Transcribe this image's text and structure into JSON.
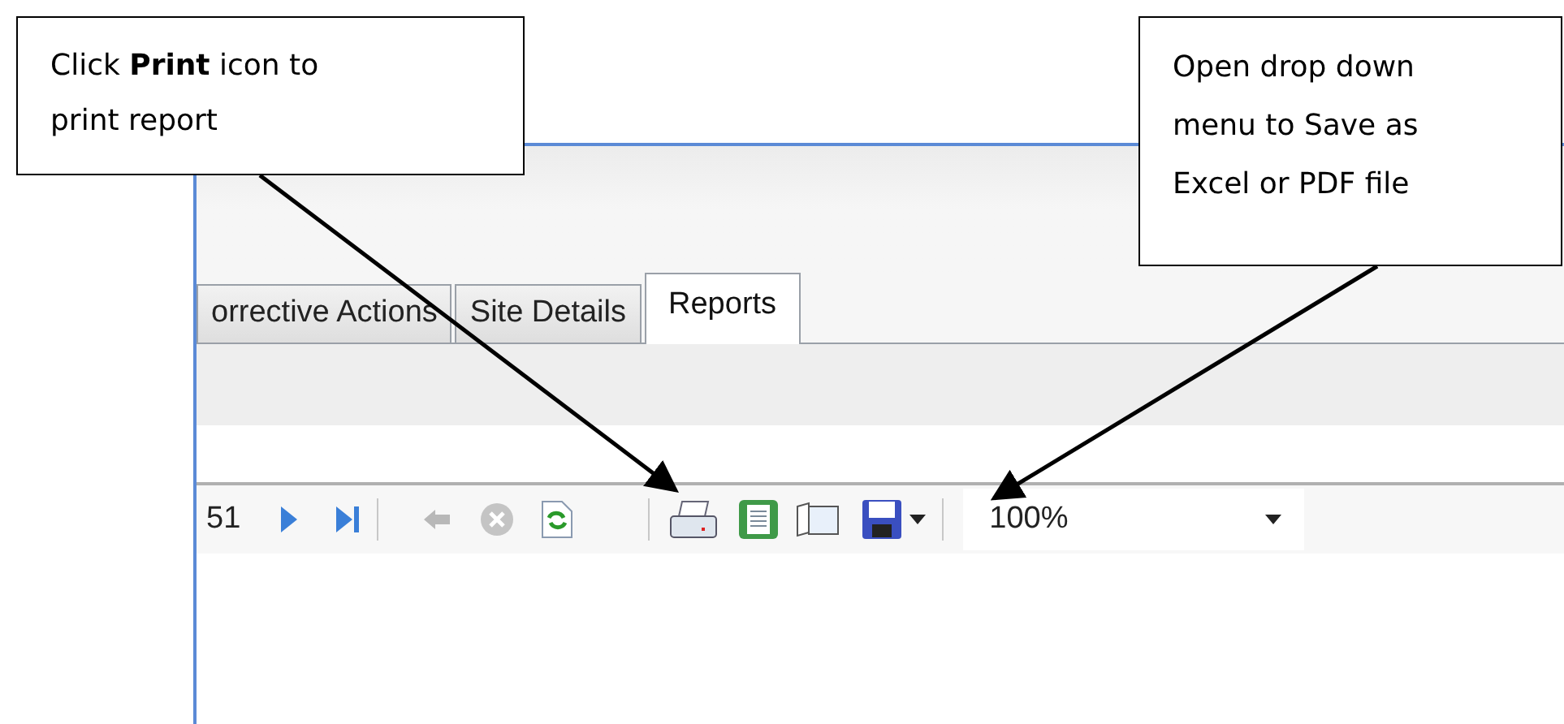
{
  "callouts": [
    {
      "text": "Click **Print** icon to print report"
    },
    {
      "text": "Open drop down menu to Save as Excel or PDF file"
    }
  ],
  "tabs": [
    {
      "label": "orrective Actions",
      "selected": false
    },
    {
      "label": "Site Details",
      "selected": false
    },
    {
      "label": "Reports",
      "selected": true
    }
  ],
  "toolbar": {
    "page": "51",
    "zoom": "100%"
  }
}
